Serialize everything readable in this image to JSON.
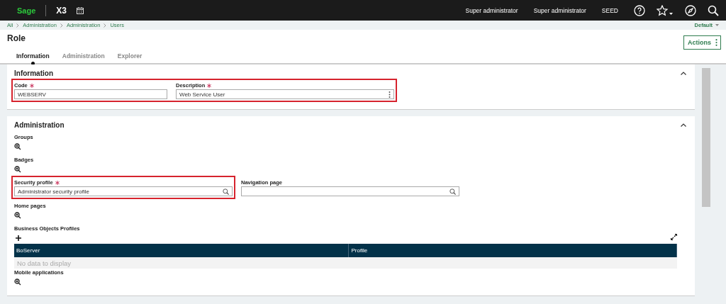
{
  "header": {
    "logo": "Sage",
    "product": "X3",
    "user_items": [
      "Super administrator",
      "Super administrator",
      "SEED"
    ]
  },
  "breadcrumb": [
    "All",
    "Administration",
    "Administration",
    "Users"
  ],
  "layout_menu": "Default",
  "page_title": "Role",
  "actions_button": "Actions",
  "tabs": [
    {
      "label": "Information",
      "selected": true
    },
    {
      "label": "Administration",
      "selected": false
    },
    {
      "label": "Explorer",
      "selected": false
    }
  ],
  "sections": [
    {
      "title": "Information",
      "expanded": true,
      "blocks": [
        {
          "kind": "fields",
          "fields": [
            {
              "label": "Code",
              "required": true,
              "highlighted": true,
              "kind": "text",
              "value": "WEBSERV"
            },
            {
              "label": "Description",
              "required": true,
              "highlighted": true,
              "kind": "menu",
              "value": "Web Service User"
            }
          ]
        }
      ]
    },
    {
      "title": "Administration",
      "expanded": true,
      "blocks": [
        {
          "kind": "collection",
          "label": "Groups"
        },
        {
          "kind": "collection",
          "label": "Badges"
        },
        {
          "kind": "fields",
          "fields": [
            {
              "label": "Security profile",
              "required": true,
              "highlighted": true,
              "kind": "lookup",
              "value": "Administrator security profile"
            },
            {
              "label": "Navigation page",
              "required": false,
              "highlighted": false,
              "kind": "lookup"
            }
          ]
        },
        {
          "kind": "collection",
          "label": "Home pages"
        },
        {
          "kind": "table",
          "label": "Business Objects Profiles",
          "columns": [
            "BoServer",
            "Profile"
          ],
          "empty_text": "No data to display"
        },
        {
          "kind": "collection",
          "label": "Mobile applications"
        }
      ]
    }
  ]
}
